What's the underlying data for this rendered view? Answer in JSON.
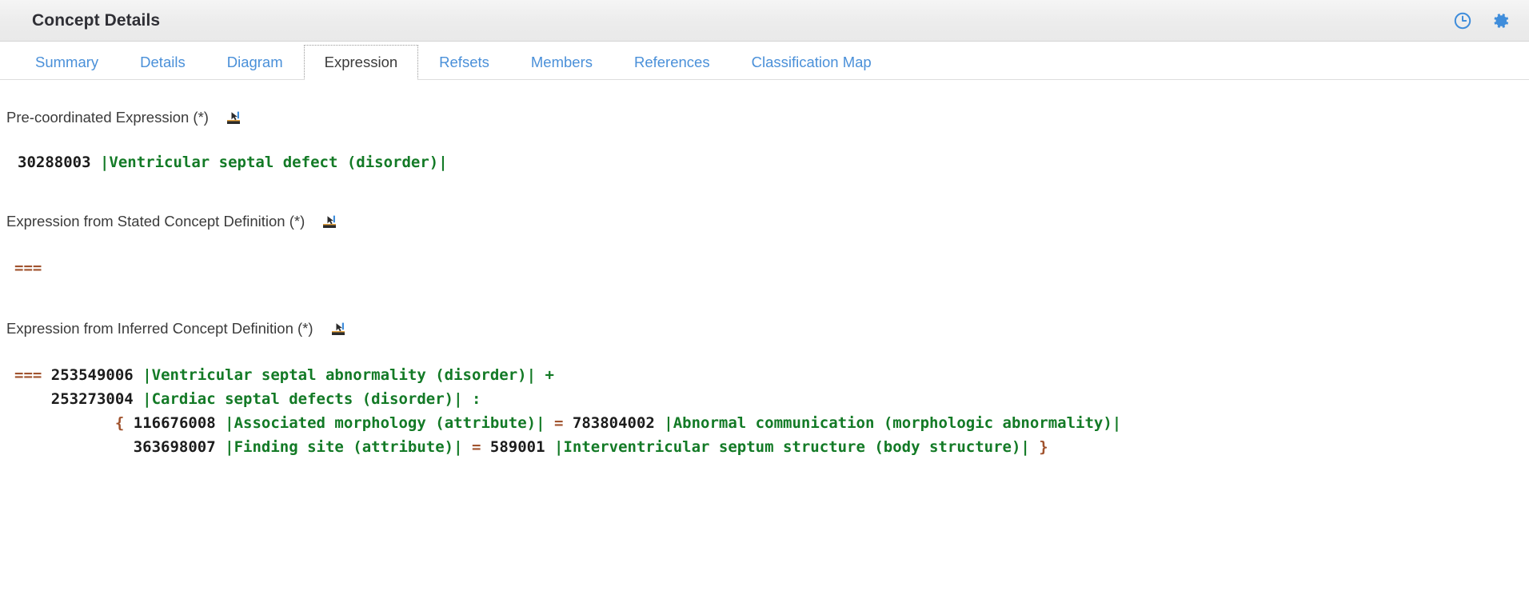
{
  "window": {
    "title": "Concept Details",
    "actions": [
      {
        "name": "history-icon",
        "label": "History"
      },
      {
        "name": "settings-gear-icon",
        "label": "Settings"
      }
    ]
  },
  "tabs": [
    {
      "label": "Summary",
      "active": false
    },
    {
      "label": "Details",
      "active": false
    },
    {
      "label": "Diagram",
      "active": false
    },
    {
      "label": "Expression",
      "active": true
    },
    {
      "label": "Refsets",
      "active": false
    },
    {
      "label": "Members",
      "active": false
    },
    {
      "label": "References",
      "active": false
    },
    {
      "label": "Classification Map",
      "active": false
    }
  ],
  "colors": {
    "link_blue": "#4a90d9",
    "term_green": "#137a26",
    "operator_brown": "#a0522d",
    "header_bg": "#ececec",
    "text_dark": "#3b3b3b"
  },
  "sections": {
    "precoordinated": {
      "title": "Pre-coordinated Expression (*)",
      "copy_icon": "stamp-icon",
      "lines": [
        {
          "indent": 0,
          "parts": [
            {
              "t": "30288003",
              "c": "id"
            },
            {
              "t": " ",
              "c": "plain"
            },
            {
              "t": "|Ventricular septal defect (disorder)|",
              "c": "term"
            }
          ]
        }
      ]
    },
    "stated": {
      "title": "Expression from Stated Concept Definition (*)",
      "copy_icon": "stamp-icon",
      "lines": [
        {
          "indent": 0,
          "parts": [
            {
              "t": "===",
              "c": "op"
            }
          ]
        }
      ]
    },
    "inferred": {
      "title": "Expression from Inferred Concept Definition (*)",
      "copy_icon": "stamp-icon",
      "lines": [
        {
          "indent": 0,
          "parts": [
            {
              "t": "===",
              "c": "op"
            },
            {
              "t": " ",
              "c": "plain"
            },
            {
              "t": "253549006",
              "c": "id"
            },
            {
              "t": " ",
              "c": "plain"
            },
            {
              "t": "|Ventricular septal abnormality (disorder)|",
              "c": "term"
            },
            {
              "t": " ",
              "c": "plain"
            },
            {
              "t": "+",
              "c": "plus"
            }
          ]
        },
        {
          "indent": 4,
          "parts": [
            {
              "t": "253273004",
              "c": "id"
            },
            {
              "t": " ",
              "c": "plain"
            },
            {
              "t": "|Cardiac septal defects (disorder)|",
              "c": "term"
            },
            {
              "t": " ",
              "c": "plain"
            },
            {
              "t": ":",
              "c": "colon"
            }
          ]
        },
        {
          "indent": 11,
          "parts": [
            {
              "t": "{",
              "c": "op"
            },
            {
              "t": " ",
              "c": "plain"
            },
            {
              "t": "116676008",
              "c": "id"
            },
            {
              "t": " ",
              "c": "plain"
            },
            {
              "t": "|Associated morphology (attribute)|",
              "c": "term"
            },
            {
              "t": " ",
              "c": "plain"
            },
            {
              "t": "=",
              "c": "op"
            },
            {
              "t": " ",
              "c": "plain"
            },
            {
              "t": "783804002",
              "c": "id"
            },
            {
              "t": " ",
              "c": "plain"
            },
            {
              "t": "|Abnormal communication (morphologic abnormality)|",
              "c": "term"
            }
          ]
        },
        {
          "indent": 13,
          "parts": [
            {
              "t": "363698007",
              "c": "id"
            },
            {
              "t": " ",
              "c": "plain"
            },
            {
              "t": "|Finding site (attribute)|",
              "c": "term"
            },
            {
              "t": " ",
              "c": "plain"
            },
            {
              "t": "=",
              "c": "op"
            },
            {
              "t": " ",
              "c": "plain"
            },
            {
              "t": "589001",
              "c": "id"
            },
            {
              "t": " ",
              "c": "plain"
            },
            {
              "t": "|Interventricular septum structure (body structure)|",
              "c": "term"
            },
            {
              "t": " ",
              "c": "plain"
            },
            {
              "t": "}",
              "c": "op"
            }
          ]
        }
      ]
    }
  }
}
